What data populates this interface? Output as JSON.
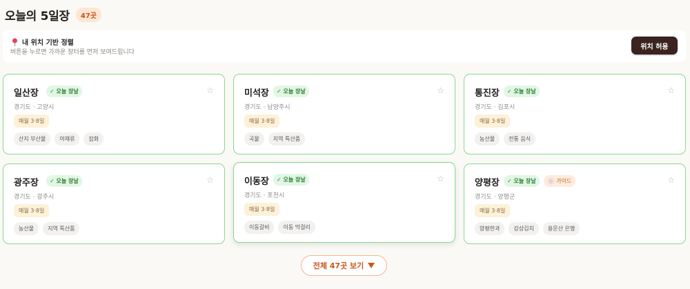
{
  "header": {
    "title": "오늘의 5일장",
    "count": "47곳"
  },
  "location": {
    "title": "내 위치 기반 정렬",
    "subtitle": "버튼을 누르면 가까운 장터를 먼저 보여드립니다",
    "button": "위치 허용"
  },
  "colors": {
    "accent": "#c8561a",
    "card_border": "#86d98c",
    "today_bg": "#e2f6e4",
    "button_dark": "#3a2320"
  },
  "markets": [
    {
      "name": "일산장",
      "today": "✓ 오늘 장날",
      "guide": "",
      "region": "경기도 · 고양시",
      "schedule": "매월 3·8일",
      "tags": [
        "산지 부산물",
        "야채류",
        "잡화"
      ]
    },
    {
      "name": "미석장",
      "today": "✓ 오늘 장날",
      "guide": "",
      "region": "경기도 · 남양주시",
      "schedule": "매월 3·8일",
      "tags": [
        "곡물",
        "지역 특산품"
      ]
    },
    {
      "name": "통진장",
      "today": "✓ 오늘 장날",
      "guide": "",
      "region": "경기도 · 김포시",
      "schedule": "매월 3·8일",
      "tags": [
        "농산물",
        "전통 음식"
      ]
    },
    {
      "name": "광주장",
      "today": "✓ 오늘 장날",
      "guide": "",
      "region": "경기도 · 광주시",
      "schedule": "매월 3·8일",
      "tags": [
        "농산물",
        "지역 특산품"
      ]
    },
    {
      "name": "이동장",
      "today": "✓ 오늘 장날",
      "guide": "",
      "region": "경기도 · 포천시",
      "schedule": "매월 3·8일",
      "tags": [
        "이동갈비",
        "이동 막걸리"
      ]
    },
    {
      "name": "양평장",
      "today": "✓ 오늘 장날",
      "guide": "🍥 가이드",
      "region": "경기도 · 양평군",
      "schedule": "매월 3·8일",
      "tags": [
        "양평한과",
        "강상김치",
        "용문산 은행"
      ]
    }
  ],
  "more_button": "전체 47곳 보기"
}
